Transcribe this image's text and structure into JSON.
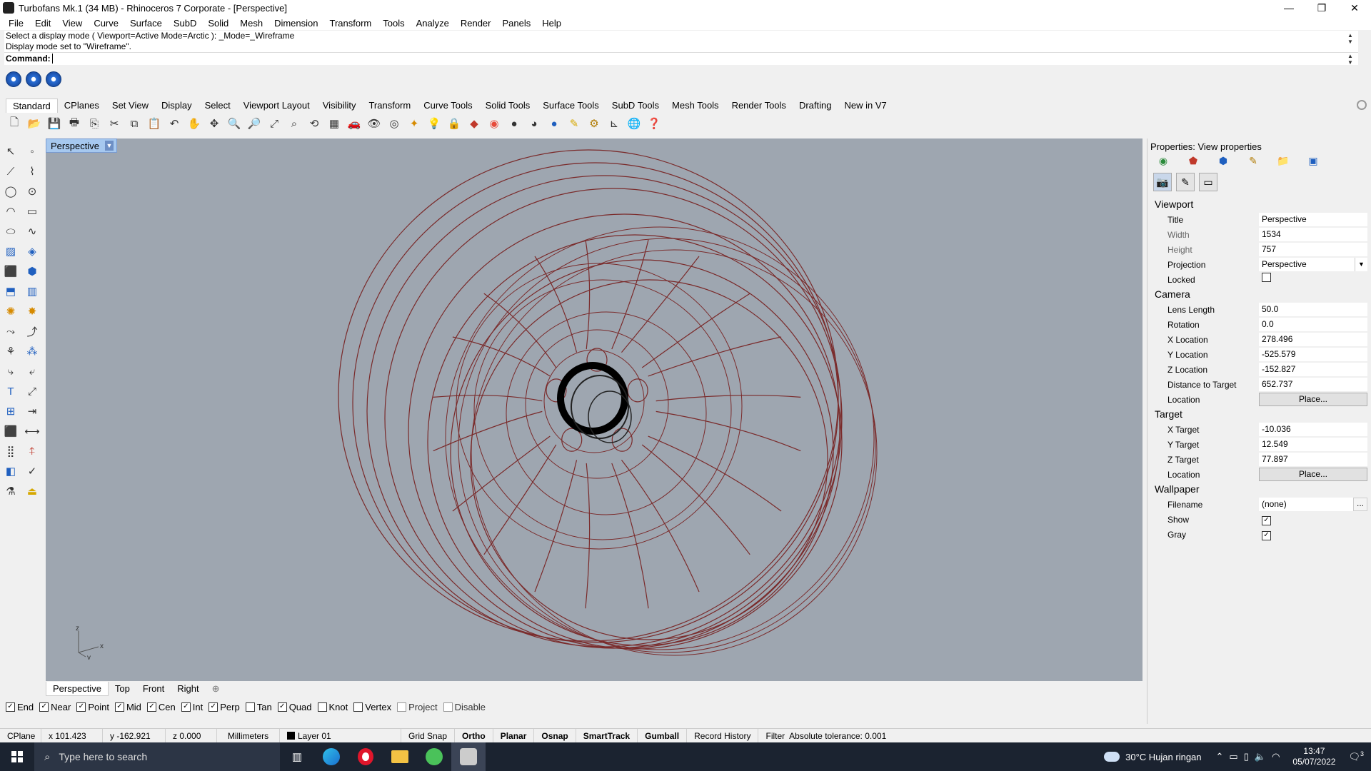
{
  "window": {
    "title": "Turbofans Mk.1 (34 MB) - Rhinoceros 7 Corporate - [Perspective]",
    "controls": [
      "—",
      "❐",
      "✕"
    ]
  },
  "menu": [
    "File",
    "Edit",
    "View",
    "Curve",
    "Surface",
    "SubD",
    "Solid",
    "Mesh",
    "Dimension",
    "Transform",
    "Tools",
    "Analyze",
    "Render",
    "Panels",
    "Help"
  ],
  "command": {
    "history_1": "Select a display mode ( Viewport=Active  Mode=Arctic ): _Mode=_Wireframe",
    "history_2": "Display mode set to \"Wireframe\".",
    "prompt": "Command:",
    "value": ""
  },
  "tabs": [
    "Standard",
    "CPlanes",
    "Set View",
    "Display",
    "Select",
    "Viewport Layout",
    "Visibility",
    "Transform",
    "Curve Tools",
    "Solid Tools",
    "Surface Tools",
    "SubD Tools",
    "Mesh Tools",
    "Render Tools",
    "Drafting",
    "New in V7"
  ],
  "active_tab": "Standard",
  "viewport": {
    "title": "Perspective",
    "axis_z": "z",
    "axis_x": "x",
    "axis_y": "y",
    "wire_color": "#7a2a2a",
    "background_color": "#9ea6b0"
  },
  "viewport_tabs": [
    "Perspective",
    "Top",
    "Front",
    "Right"
  ],
  "viewport_tab_add": "⊕",
  "osnaps": [
    {
      "label": "End",
      "checked": true
    },
    {
      "label": "Near",
      "checked": true
    },
    {
      "label": "Point",
      "checked": true
    },
    {
      "label": "Mid",
      "checked": true
    },
    {
      "label": "Cen",
      "checked": true
    },
    {
      "label": "Int",
      "checked": true
    },
    {
      "label": "Perp",
      "checked": true
    },
    {
      "label": "Tan",
      "checked": false
    },
    {
      "label": "Quad",
      "checked": true
    },
    {
      "label": "Knot",
      "checked": false
    },
    {
      "label": "Vertex",
      "checked": false
    },
    {
      "label": "Project",
      "checked": false
    },
    {
      "label": "Disable",
      "checked": false
    }
  ],
  "status": {
    "cplane": "CPlane",
    "x": "x 101.423",
    "y": "y -162.921",
    "z": "z 0.000",
    "units": "Millimeters",
    "layer": "Layer 01",
    "grid_snap": "Grid Snap",
    "ortho": "Ortho",
    "planar": "Planar",
    "osnap": "Osnap",
    "smarttrack": "SmartTrack",
    "gumball": "Gumball",
    "record_history": "Record History",
    "filter": "Filter",
    "tolerance": "Absolute tolerance: 0.001"
  },
  "properties": {
    "header": "Properties: View properties",
    "viewport_section": "Viewport",
    "title_label": "Title",
    "title_value": "Perspective",
    "width_label": "Width",
    "width_value": "1534",
    "height_label": "Height",
    "height_value": "757",
    "projection_label": "Projection",
    "projection_value": "Perspective",
    "locked_label": "Locked",
    "locked_checked": false,
    "camera_section": "Camera",
    "lens_label": "Lens Length",
    "lens_value": "50.0",
    "rotation_label": "Rotation",
    "rotation_value": "0.0",
    "xloc_label": "X Location",
    "xloc_value": "278.496",
    "yloc_label": "Y Location",
    "yloc_value": "-525.579",
    "zloc_label": "Z Location",
    "zloc_value": "-152.827",
    "dist_label": "Distance to Target",
    "dist_value": "652.737",
    "loc_label": "Location",
    "place_label": "Place...",
    "target_section": "Target",
    "xt_label": "X Target",
    "xt_value": "-10.036",
    "yt_label": "Y Target",
    "yt_value": "12.549",
    "zt_label": "Z Target",
    "zt_value": "77.897",
    "tloc_label": "Location",
    "tplace_label": "Place...",
    "wallpaper_section": "Wallpaper",
    "filename_label": "Filename",
    "filename_value": "(none)",
    "browse_label": "...",
    "show_label": "Show",
    "show_checked": true,
    "gray_label": "Gray",
    "gray_checked": true
  },
  "taskbar": {
    "search_placeholder": "Type here to search",
    "weather": "30°C  Hujan ringan",
    "time": "13:47",
    "date": "05/07/2022",
    "notification_count": "3"
  }
}
